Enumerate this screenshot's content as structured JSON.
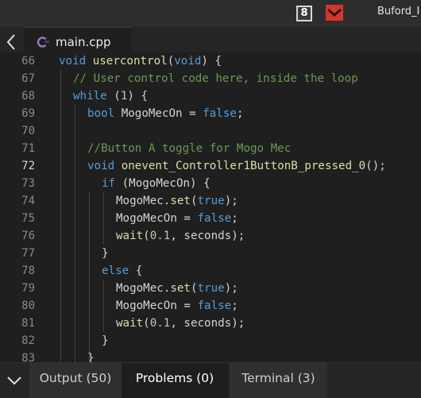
{
  "window": {
    "title": "Buford_I",
    "badge_number": "8",
    "icons": [
      "numbered-square-icon",
      "red-app-icon"
    ]
  },
  "tab": {
    "filename": "main.cpp",
    "icon": "cpp-file-icon",
    "back_icon": "chevron-left-icon"
  },
  "editor": {
    "active_line": "72",
    "lines": [
      {
        "num": "66",
        "text": "void usercontrol(void) {"
      },
      {
        "num": "67",
        "text": "// User control code here, inside the loop"
      },
      {
        "num": "68",
        "text": "while (1) {"
      },
      {
        "num": "69",
        "text": "bool MogoMecOn = false;"
      },
      {
        "num": "70",
        "text": ""
      },
      {
        "num": "71",
        "text": "//Button A toggle for Mogo Mec"
      },
      {
        "num": "72",
        "text": "void onevent_Controller1ButtonB_pressed_0();"
      },
      {
        "num": "73",
        "text": "if (MogoMecOn) {"
      },
      {
        "num": "74",
        "text": "MogoMec.set(true);"
      },
      {
        "num": "75",
        "text": "MogoMecOn = false;"
      },
      {
        "num": "76",
        "text": "wait(0.1, seconds);"
      },
      {
        "num": "77",
        "text": "}"
      },
      {
        "num": "78",
        "text": "else {"
      },
      {
        "num": "79",
        "text": "MogoMec.set(true);"
      },
      {
        "num": "80",
        "text": "MogoMecOn = false;"
      },
      {
        "num": "81",
        "text": "wait(0.1, seconds);"
      },
      {
        "num": "82",
        "text": "}"
      },
      {
        "num": "83",
        "text": "}"
      }
    ]
  },
  "panel": {
    "toggle_icon": "chevron-down-icon",
    "tabs": [
      {
        "label": "Output (50)",
        "active": false
      },
      {
        "label": "Problems (0)",
        "active": true
      },
      {
        "label": "Terminal (3)",
        "active": false
      }
    ]
  },
  "colors": {
    "keyword": "#569cd6",
    "function": "#dcdcaa",
    "comment": "#6a9955",
    "number": "#b5cea8",
    "text": "#d4d4d4",
    "background": "#1f1f1f"
  }
}
